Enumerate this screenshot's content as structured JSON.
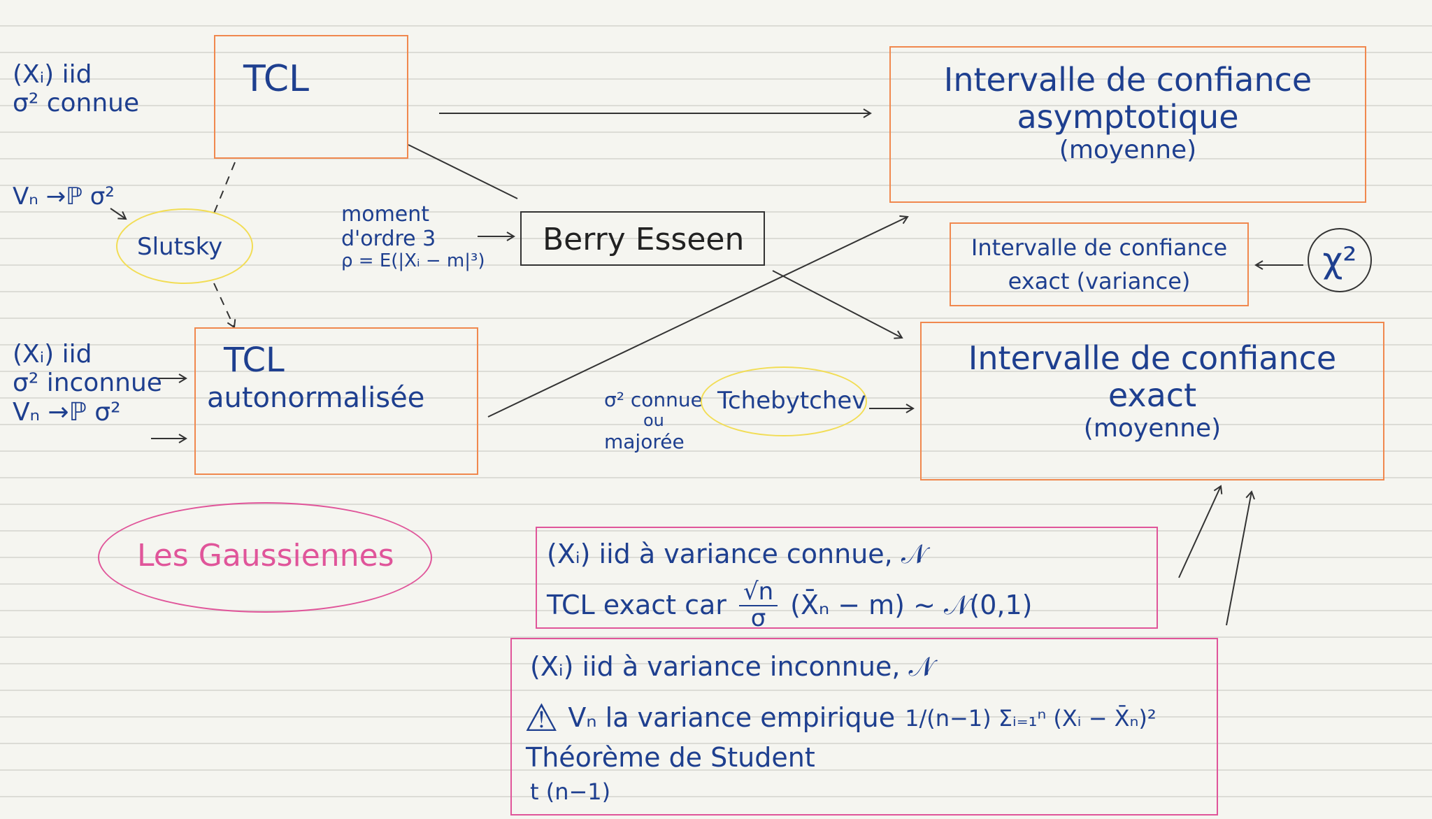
{
  "colors": {
    "ink": "#1e3f8f",
    "orange": "#f0884e",
    "pink": "#e0559a",
    "yellow": "#f2dd55",
    "dark": "#333333"
  },
  "left": {
    "hyp1_line1": "(Xᵢ) iid",
    "hyp1_line2": "σ² connue",
    "vn_conv_1": "Vₙ →ℙ σ²",
    "hyp2_line1": "(Xᵢ) iid",
    "hyp2_line2": "σ² inconnue",
    "hyp2_line3": "Vₙ →ℙ σ²"
  },
  "tcl": "TCL",
  "tcl_auto_line1": "TCL",
  "tcl_auto_line2": "autonormalisée",
  "slutsky": "Slutsky",
  "berry": {
    "note_line1": "moment",
    "note_line2": "d'ordre 3",
    "note_line3": "ρ = E(|Xᵢ − m|³)",
    "label": "Berry Esseen"
  },
  "ic_asym": {
    "line1": "Intervalle de confiance",
    "line2": "asymptotique",
    "line3": "(moyenne)"
  },
  "ic_var": {
    "line1": "Intervalle de confiance",
    "line2": "exact (variance)"
  },
  "chi2": "χ²",
  "ic_exact": {
    "line1": "Intervalle de confiance",
    "line2": "exact",
    "line3": "(moyenne)"
  },
  "tchebytchev": {
    "label": "Tchebytchev",
    "note_line1": "σ² connue",
    "note_line2": "ou",
    "note_line3": "majorée"
  },
  "gaussiennes": "Les Gaussiennes",
  "known_var": {
    "line1": "(Xᵢ) iid à variance connue, 𝒩",
    "line2_prefix": "TCL exact car",
    "frac_num": "√n",
    "frac_den": "σ",
    "line2_suffix": "(X̄ₙ − m) ~ 𝒩(0,1)"
  },
  "unknown_var": {
    "line1": "(Xᵢ) iid à variance inconnue, 𝒩",
    "warning_symbol": "⚠",
    "line2": "Vₙ la variance empirique",
    "formula": "1/(n−1) Σᵢ₌₁ⁿ (Xᵢ − X̄ₙ)²",
    "line3": "Théorème de Student",
    "line4": "t (n−1)"
  }
}
